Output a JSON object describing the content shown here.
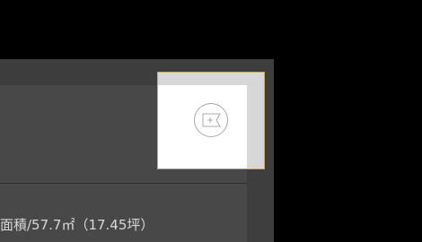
{
  "property": {
    "area_label": "面積/57.7㎡（17.45坪）"
  },
  "card": {
    "action_icon": "flag-plus-icon"
  },
  "colors": {
    "background": "#000000",
    "panel": "#484848",
    "card_border": "#c9a86a",
    "card_bg": "#ffffff",
    "icon_stroke": "#a8a8a8"
  }
}
